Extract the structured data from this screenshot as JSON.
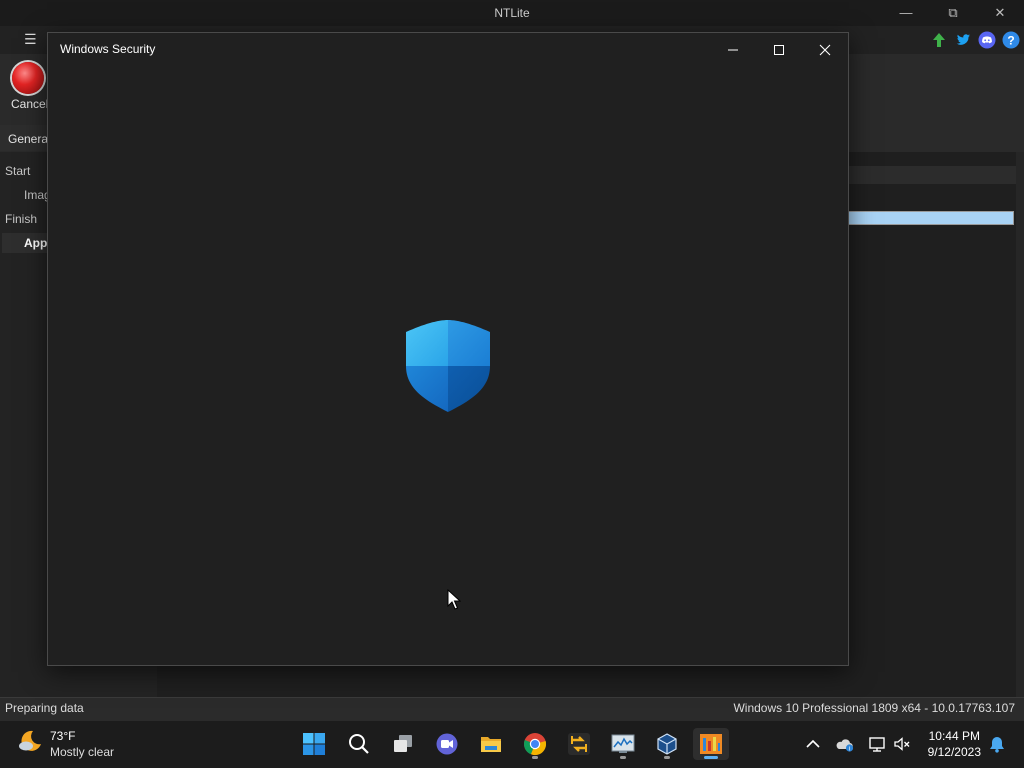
{
  "ntlite": {
    "title": "NTLite",
    "ribbon": {
      "cancel_label": "Cancel",
      "general_tab": "General"
    },
    "nav": {
      "start": "Start",
      "image": "Image",
      "finish": "Finish",
      "apply": "Apply"
    },
    "progress": 1.0,
    "status": {
      "left": "Preparing data",
      "right": "Windows 10 Professional 1809 x64 - 10.0.17763.107"
    }
  },
  "dialog": {
    "title": "Windows Security"
  },
  "taskbar": {
    "weather": {
      "temp": "73°F",
      "condition": "Mostly clear"
    },
    "clock": {
      "time": "10:44 PM",
      "date": "9/12/2023"
    }
  },
  "colors": {
    "accent": "#5fb2f2",
    "shield_light": "#35b3ee",
    "shield_dark": "#0a5fb4",
    "progress": "#a9d3f5"
  }
}
